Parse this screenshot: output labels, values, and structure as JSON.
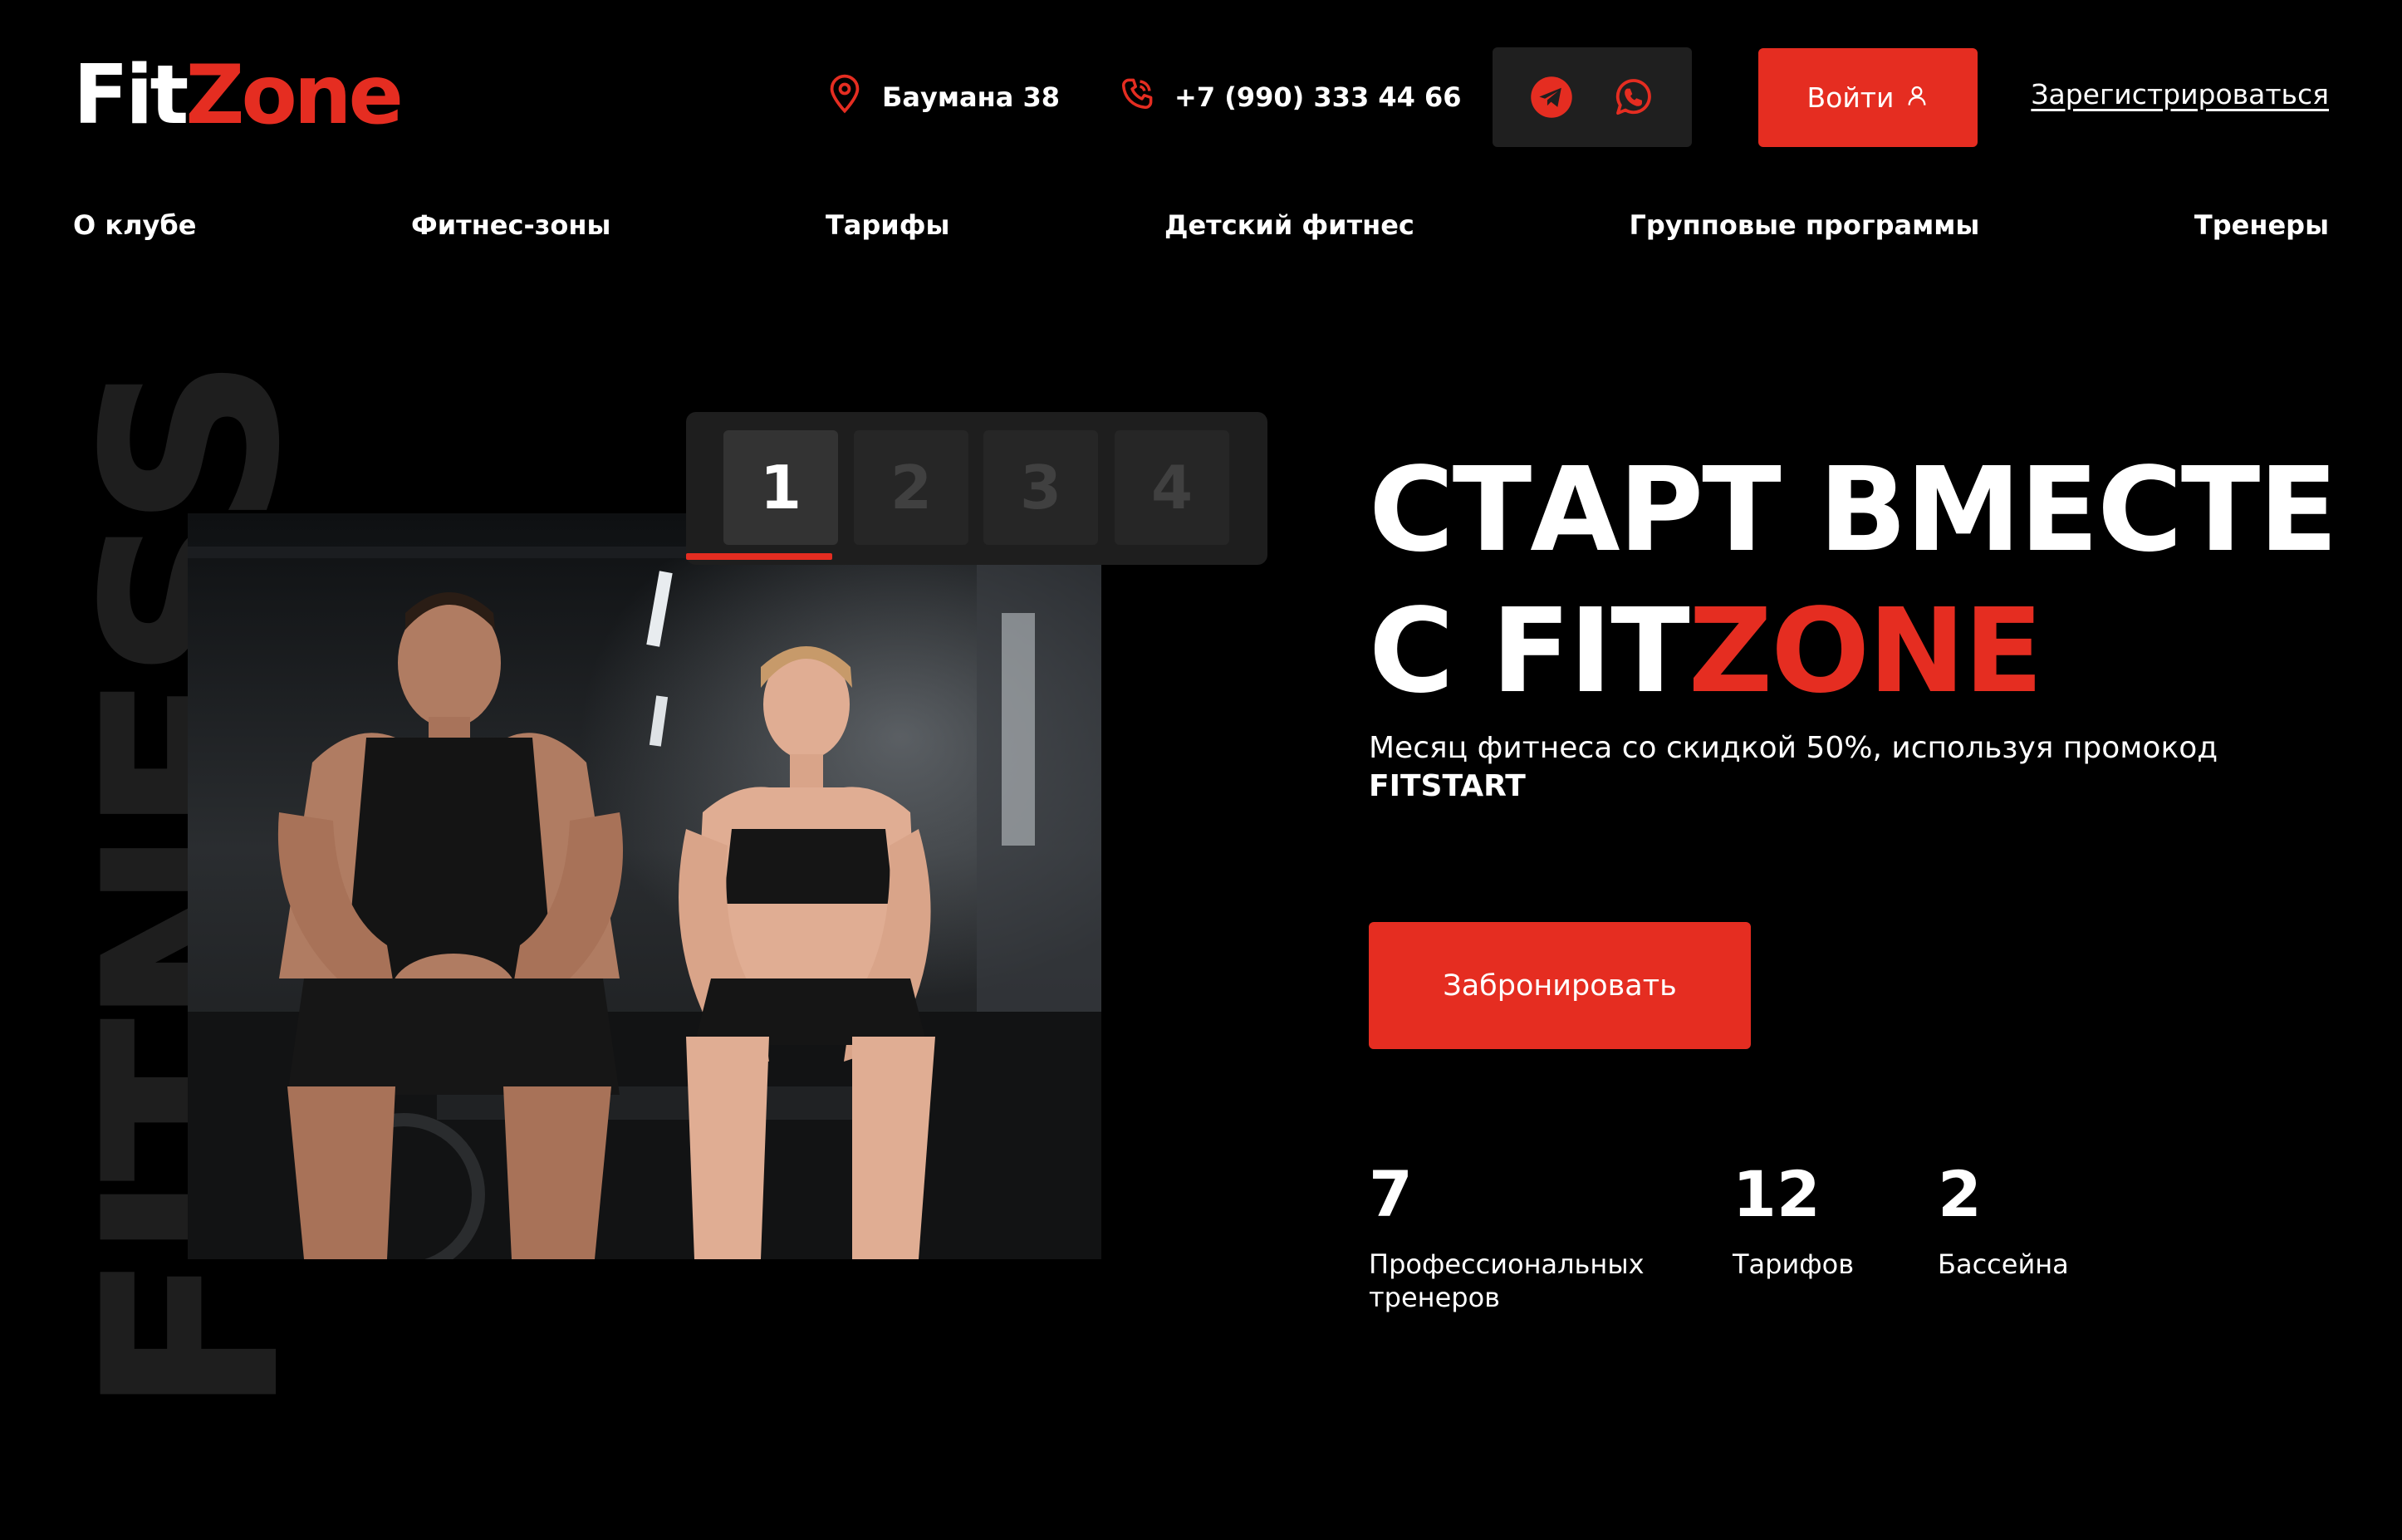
{
  "header": {
    "logo_part1": "Fit",
    "logo_part2": "Zone",
    "address": "Баумана 38",
    "phone": "+7 (990) 333 44 66",
    "social": [
      "telegram-icon",
      "whatsapp-icon"
    ],
    "login_label": "Войти",
    "register_label": "Зарегистрироваться"
  },
  "nav": [
    "О клубе",
    "Фитнес-зоны",
    "Тарифы",
    "Детский фитнес",
    "Групповые программы",
    "Тренеры"
  ],
  "hero": {
    "background_word": "FITNESS",
    "slides": [
      "1",
      "2",
      "3",
      "4"
    ],
    "active_slide": 1,
    "headline_line1": "СТАРТ ВМЕСТЕ",
    "headline_line2_prefix": "С FIT",
    "headline_line2_accent": "ZONE",
    "subtitle": "Месяц фитнеса со скидкой 50%, используя промокод",
    "promo_code": "FITSTART",
    "cta_label": "Забронировать"
  },
  "stats": [
    {
      "value": "7",
      "label_line1": "Профессиональных",
      "label_line2": "тренеров"
    },
    {
      "value": "12",
      "label_line1": "Тарифов",
      "label_line2": ""
    },
    {
      "value": "2",
      "label_line1": "Бассейна",
      "label_line2": ""
    }
  ],
  "colors": {
    "accent": "#e52d21",
    "background": "#000000",
    "panel": "#1e1e1e"
  }
}
